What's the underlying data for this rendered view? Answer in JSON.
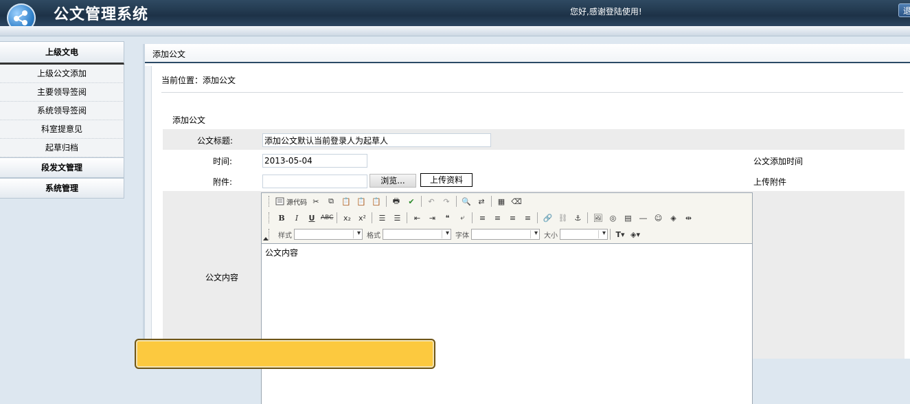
{
  "header": {
    "title": "公文管理系统",
    "welcome": "您好,感谢登陆使用!",
    "exit_label": "退"
  },
  "sidebar": {
    "sections": [
      {
        "label": "上级文电",
        "items": [
          "上级公文添加",
          "主要领导签阅",
          "系统领导签阅",
          "科室提意见",
          "起草归档"
        ]
      },
      {
        "label": "段发文管理"
      },
      {
        "label": "系统管理"
      }
    ]
  },
  "main": {
    "panel_title": "添加公文",
    "breadcrumb": "当前位置：添加公文",
    "form_title": "添加公文",
    "fields": {
      "title_label": "公文标题:",
      "title_value": "添加公文默认当前登录人为起草人",
      "time_label": "时间:",
      "time_value": "2013-05-04",
      "time_hint": "公文添加时间",
      "attach_label": "附件:",
      "browse_label": "浏览...",
      "upload_label": "上传资料",
      "attach_hint": "上传附件",
      "content_label": "公文内容"
    },
    "editor": {
      "source_label": "源代码",
      "style_label": "样式",
      "format_label": "格式",
      "font_label": "字体",
      "size_label": "大小",
      "content": "公文内容"
    }
  },
  "colors": {
    "header_bg": "#1d3247",
    "panel_border": "#2b4a66",
    "overlay_bg": "#fcc93f"
  }
}
